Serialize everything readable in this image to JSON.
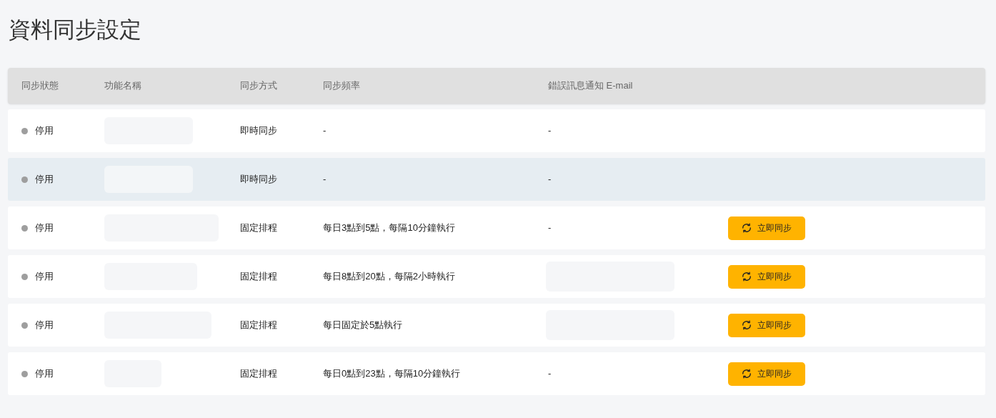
{
  "page_title": "資料同步設定",
  "table": {
    "columns": [
      "同步狀態",
      "功能名稱",
      "同步方式",
      "同步頻率",
      "錯誤訊息通知 E-mail"
    ],
    "rows": [
      {
        "status": "停用",
        "color": "#9e9e9e",
        "selected": false,
        "name_redacted": true,
        "method": "即時同步",
        "frequency": "-",
        "email": "-",
        "email_redacted": false
      },
      {
        "status": "停用",
        "color": "#9e9e9e",
        "selected": true,
        "name_redacted": true,
        "method": "即時同步",
        "frequency": "-",
        "email": "-",
        "email_redacted": false
      },
      {
        "status": "停用",
        "color": "#9e9e9e",
        "selected": false,
        "name_redacted": true,
        "method": "固定排程",
        "frequency": "每日3點到5點，每隔10分鐘執行",
        "email": "-",
        "email_redacted": false,
        "action": "立即同步"
      },
      {
        "status": "停用",
        "color": "#9e9e9e",
        "selected": false,
        "name_redacted": true,
        "method": "固定排程",
        "frequency": "每日8點到20點，每隔2小時執行",
        "email_redacted": true,
        "action": "立即同步"
      },
      {
        "status": "停用",
        "color": "#9e9e9e",
        "selected": false,
        "name_redacted": true,
        "method": "固定排程",
        "frequency": "每日固定於5點執行",
        "email_redacted": true,
        "action": "立即同步"
      },
      {
        "status": "停用",
        "color": "#9e9e9e",
        "selected": false,
        "name_redacted": true,
        "method": "固定排程",
        "frequency": "每日0點到23點，每隔10分鐘執行",
        "email": "-",
        "email_redacted": false,
        "action": "立即同步"
      }
    ]
  }
}
